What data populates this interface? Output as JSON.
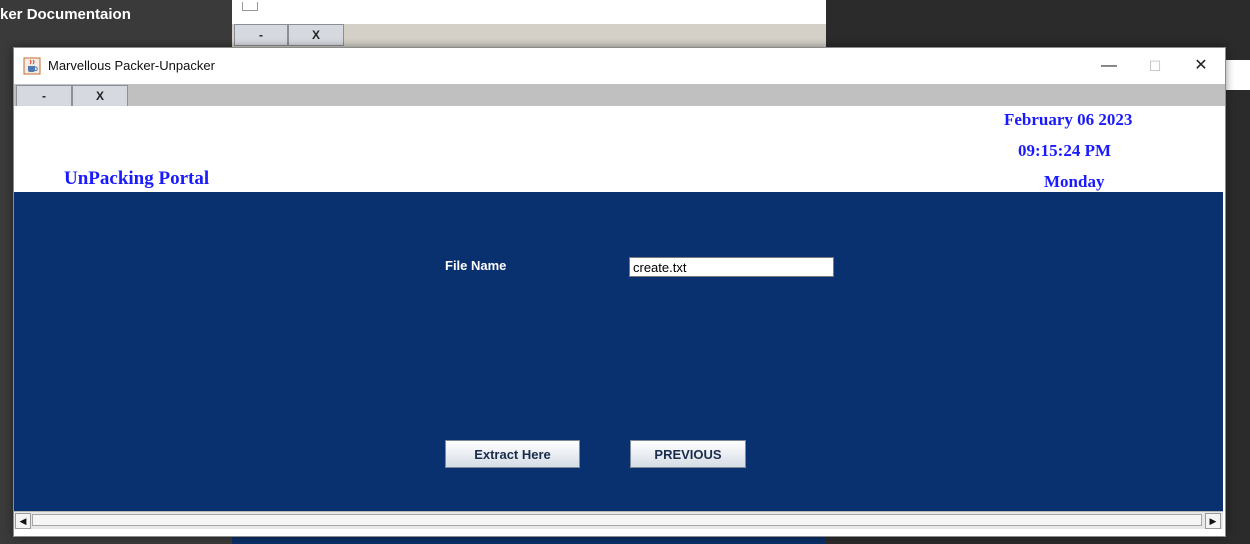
{
  "background": {
    "left_title": "ker Documentaion",
    "tab_buttons": {
      "minimize_label": "-",
      "close_label": "X"
    }
  },
  "window": {
    "title": "Marvellous Packer-Unpacker",
    "controls": {
      "minimize": "—",
      "maximize": "☐",
      "close": "✕"
    }
  },
  "menu_strip": {
    "minimize_label": "-",
    "close_label": "X"
  },
  "header": {
    "portal_title": "UnPacking Portal",
    "date": "February 06 2023",
    "time": "09:15:24 PM",
    "day": "Monday"
  },
  "form": {
    "file_name_label": "File Name",
    "file_name_value": "create.txt"
  },
  "buttons": {
    "extract": "Extract Here",
    "previous": "PREVIOUS"
  },
  "scrollbar": {
    "left_arrow": "◀",
    "right_arrow": "▶"
  },
  "colors": {
    "content_bg": "#0a316f",
    "header_text": "#1a1aff",
    "menu_strip": "#c0c0c0"
  },
  "icons": {
    "app": "java-coffee-cup-icon"
  }
}
